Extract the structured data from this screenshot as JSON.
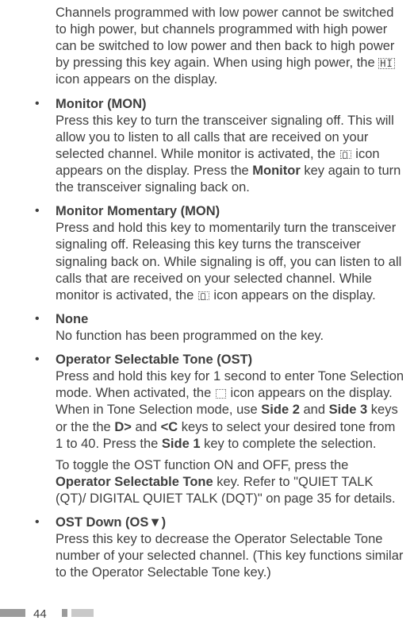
{
  "intro": {
    "part1": "Channels programmed with low power cannot be switched to high power, but channels programmed with high power can be switched to low power and then back to high power by pressing this key again.  When using high power, the ",
    "part2": " icon appears on the display."
  },
  "items": [
    {
      "title": "Monitor (MON)",
      "body_parts": [
        "Press this key to turn the transceiver signaling off.  This will allow you to listen to all calls that are received on your selected channel.  While monitor is activated, the ",
        " icon appears on the display.  Press the ",
        " key again to turn the transceiver signaling back on."
      ],
      "bold_in_body": "Monitor",
      "has_icon": "mon"
    },
    {
      "title": "Monitor Momentary (MON)",
      "body_parts": [
        "Press and hold this key to momentarily turn the transceiver signaling off.  Releasing this key turns the transceiver signaling back on.  While signaling is off, you can listen to all calls that are received on your selected channel.  While monitor is activated, the ",
        " icon appears on the display."
      ],
      "has_icon": "mon"
    },
    {
      "title": "None",
      "body": "No function has been programmed on the key."
    },
    {
      "title": "Operator Selectable Tone (OST)",
      "body1_parts": [
        "Press and hold this key for 1 second to enter Tone Selection mode.  When activated, the ",
        " icon appears on the display.  When in Tone Selection mode, use ",
        " and ",
        " keys or the the ",
        " and ",
        " keys to select your desired tone from 1 to 40.  Press the ",
        " key to complete the selection."
      ],
      "bold1": "Side 2",
      "bold2": "Side 3",
      "bold3": "D>",
      "bold4": "<C",
      "bold5": "Side 1",
      "body2_parts": [
        "To toggle the OST function ON and OFF, press the ",
        " key.  Refer to \"QUIET TALK (QT)/ DIGITAL QUIET TALK (DQT)\" on page 35 for details."
      ],
      "bold6": "Operator Selectable Tone",
      "has_icon": "ost"
    },
    {
      "title": "OST Down (OS▼)",
      "body": "Press this key to decrease the Operator Selectable Tone number of your selected channel.  (This key functions similar to the Operator Selectable Tone key.)"
    }
  ],
  "page_number": "44",
  "icons": {
    "hi": "HI"
  }
}
